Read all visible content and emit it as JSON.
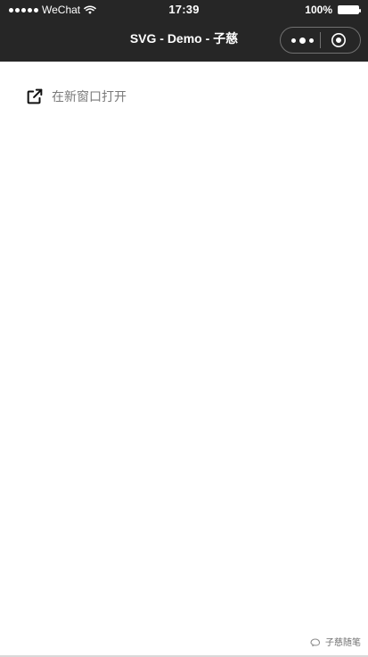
{
  "status_bar": {
    "carrier": "WeChat",
    "time": "17:39",
    "battery": "100%"
  },
  "navbar": {
    "title": "SVG - Demo - 子慈"
  },
  "content": {
    "open_in_new_window_label": "在新窗口打开"
  },
  "watermark": {
    "text": "子慈随笔"
  },
  "colors": {
    "nav_background": "#262626",
    "page_background": "#ffffff",
    "link_text": "#7a7a7a"
  }
}
